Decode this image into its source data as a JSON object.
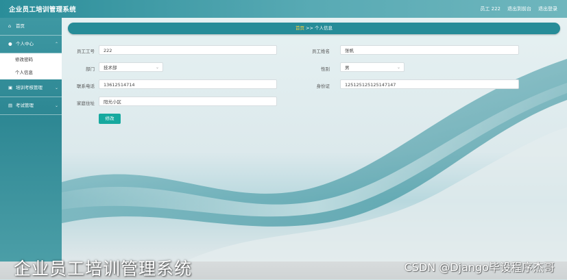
{
  "header": {
    "app_title": "企业员工培训管理系统",
    "user_label": "员工 222",
    "back_to_front": "退出到前台",
    "logout": "退出登录"
  },
  "sidebar": {
    "items": [
      {
        "label": "首页",
        "icon": "home-icon"
      },
      {
        "label": "个人中心",
        "icon": "user-icon",
        "expanded": true,
        "subitems": [
          {
            "label": "修改密码"
          },
          {
            "label": "个人信息"
          }
        ]
      },
      {
        "label": "培训考核管理",
        "icon": "folder-icon"
      },
      {
        "label": "考试管理",
        "icon": "document-icon"
      }
    ]
  },
  "breadcrumb": {
    "home": "首页",
    "separator": ">>",
    "current": "个人信息"
  },
  "form": {
    "employee_no_label": "员工工号",
    "employee_no_value": "222",
    "employee_name_label": "员工姓名",
    "employee_name_value": "张帆",
    "department_label": "部门",
    "department_value": "技术部",
    "gender_label": "性别",
    "gender_value": "男",
    "phone_label": "联系电话",
    "phone_value": "13612514714",
    "id_card_label": "身份证",
    "id_card_value": "125125125125147147",
    "address_label": "家庭住址",
    "address_value": "阳光小区",
    "edit_button": "修改"
  },
  "caption": {
    "title": "企业员工培训管理系统",
    "watermark": "CSDN @Django毕设程序杰哥"
  },
  "colors": {
    "header": "#2a8d99",
    "breadcrumb": "#268c98",
    "accent_button": "#16a99f",
    "breadcrumb_home": "#ffd23c"
  }
}
